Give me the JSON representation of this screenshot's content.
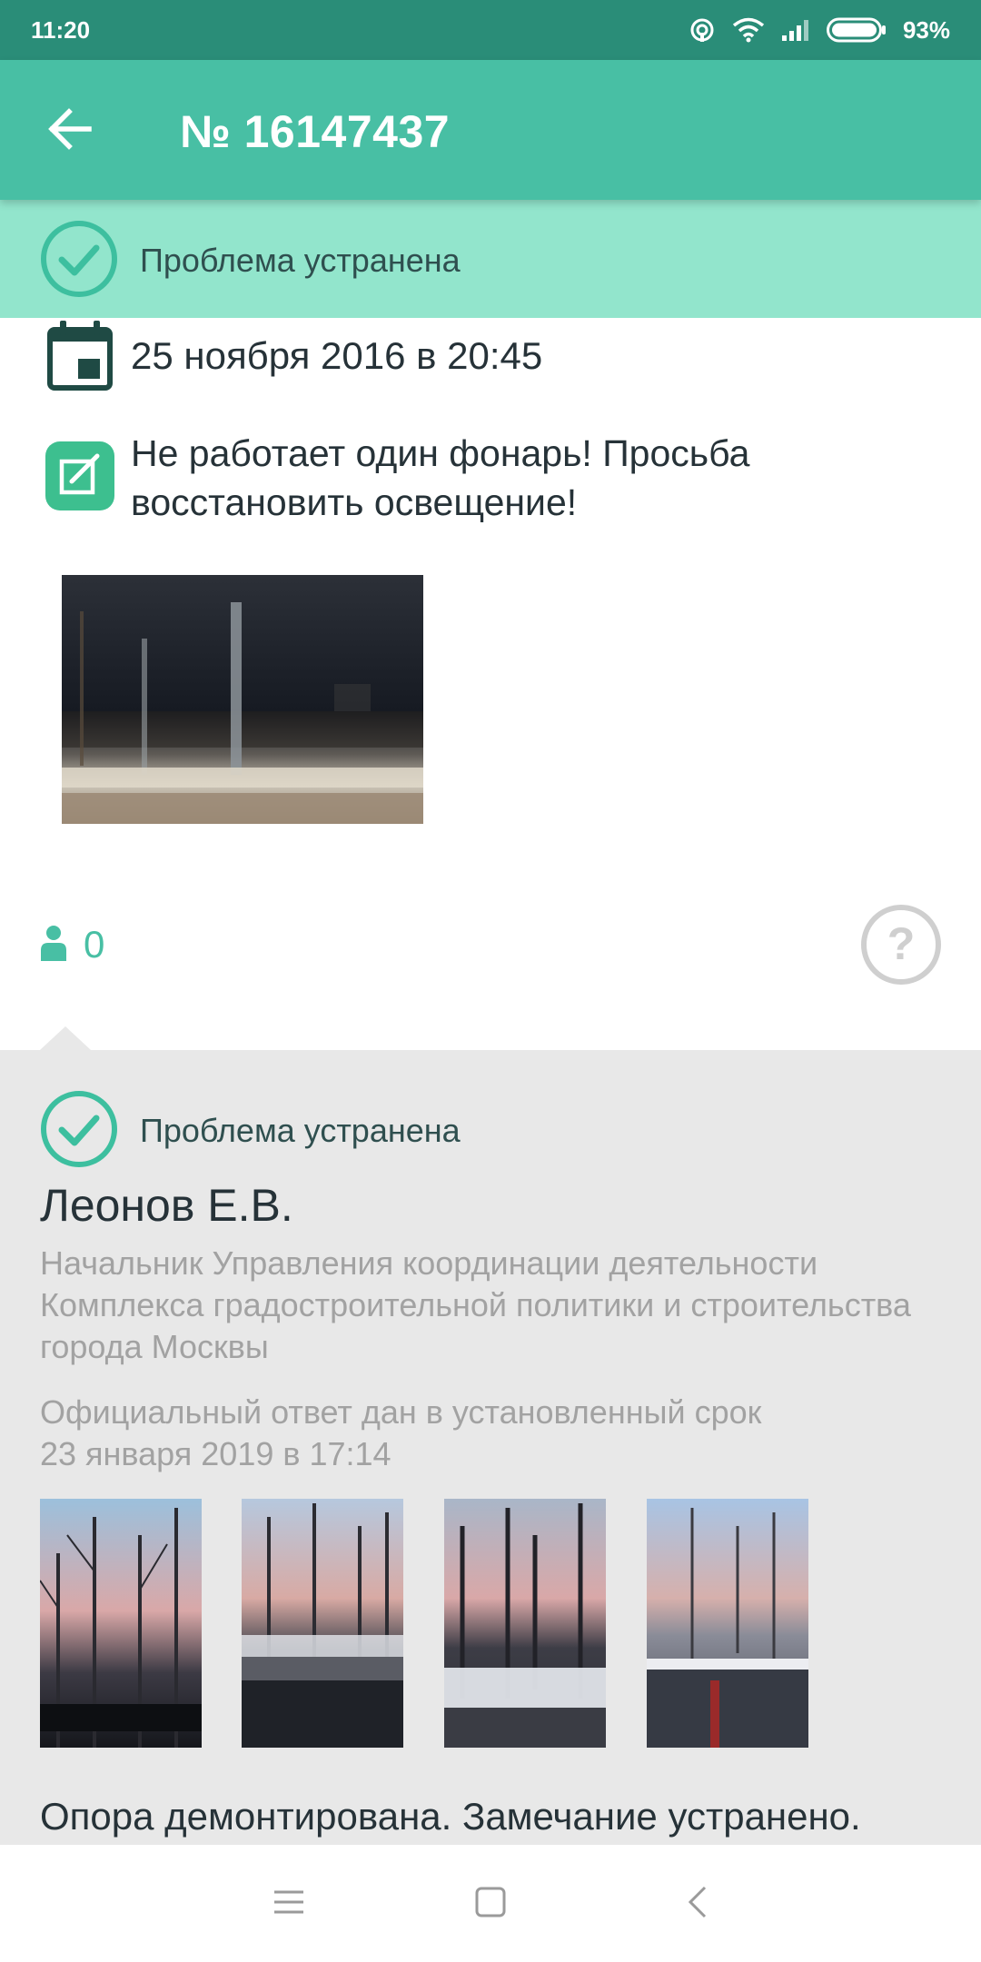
{
  "status_bar": {
    "time": "11:20",
    "battery": "93%",
    "icons": [
      "hotspot-icon",
      "wifi-icon",
      "signal-icon",
      "battery-icon"
    ]
  },
  "app_bar": {
    "title": "№ 16147437",
    "back_icon": "arrow-left-icon"
  },
  "status_banner": {
    "text": "Проблема устранена",
    "icon": "check-circle-icon"
  },
  "issue": {
    "date": "25 ноября 2016 в 20:45",
    "description": "Не работает один фонарь! Просьба восстановить освещение!",
    "supporters_count": "0"
  },
  "response": {
    "status": "Проблема устранена",
    "official_name": "Леонов Е.В.",
    "official_position": "Начальник Управления координации деятельности Комплекса градостроительной политики и строительства города Москвы",
    "official_note": "Официальный ответ дан в установленный срок",
    "response_date": "23 января 2019 в 17:14",
    "comment": "Опора демонтирована. Замечание устранено."
  },
  "colors": {
    "status_bar": "#2a8d78",
    "app_bar": "#48bfa4",
    "banner": "#92e5cc",
    "accent": "#48bfa4",
    "response_bg": "#e8e8e8"
  },
  "nav_bar": {
    "icons": [
      "menu-icon",
      "home-icon",
      "back-icon"
    ]
  }
}
